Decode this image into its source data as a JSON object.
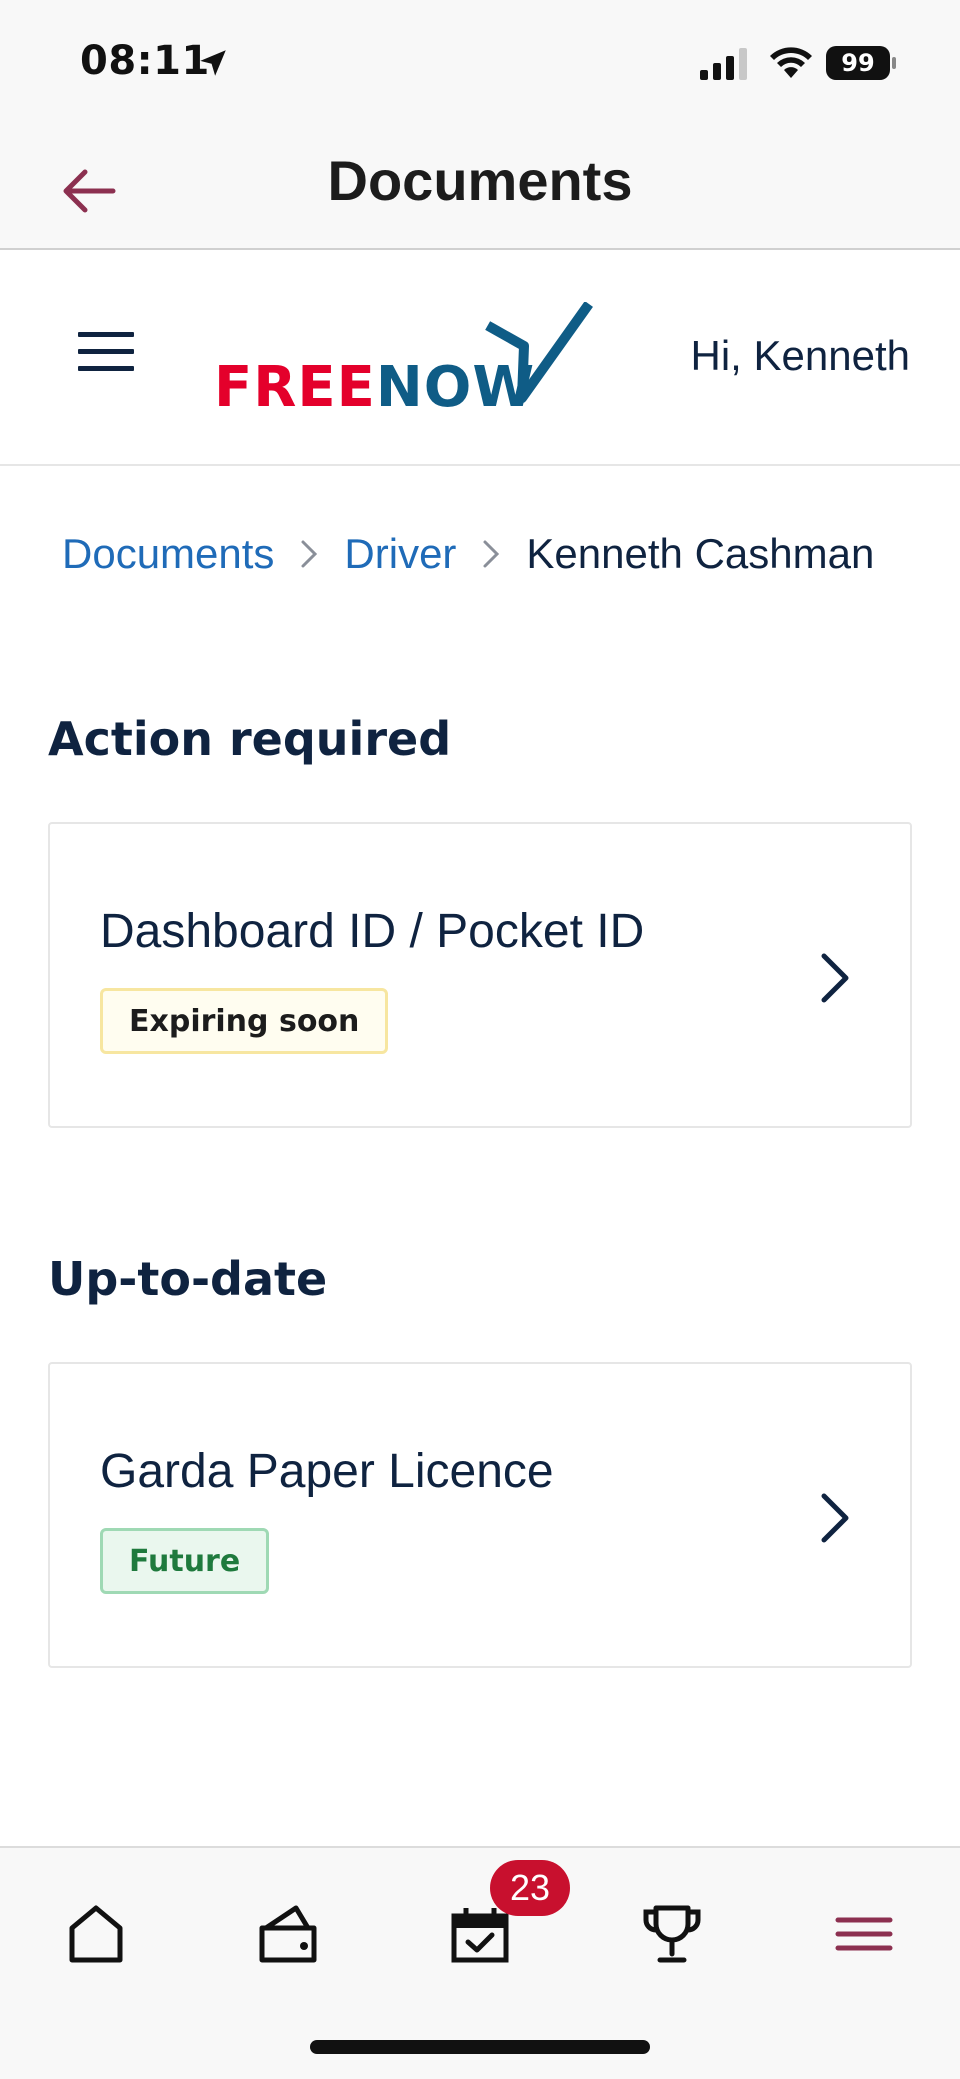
{
  "status_bar": {
    "time": "08:11",
    "battery": "99"
  },
  "nav": {
    "title": "Documents"
  },
  "header": {
    "logo_text_red": "FREE",
    "logo_text_blue": "NOW",
    "greeting": "Hi, Kenneth"
  },
  "breadcrumb": {
    "items": [
      "Documents",
      "Driver",
      "Kenneth Cashman"
    ]
  },
  "sections": [
    {
      "title": "Action required",
      "cards": [
        {
          "title": "Dashboard ID / Pocket ID",
          "badge": "Expiring soon"
        }
      ]
    },
    {
      "title": "Up-to-date",
      "cards": [
        {
          "title": "Garda Paper Licence",
          "badge": "Future"
        }
      ]
    }
  ],
  "bottom_bar": {
    "calendar_badge": "23"
  },
  "colors": {
    "brand_red": "#e4002b",
    "brand_blue": "#0f5c86",
    "accent_maroon": "#8c3050",
    "link_blue": "#1f6bb8"
  }
}
